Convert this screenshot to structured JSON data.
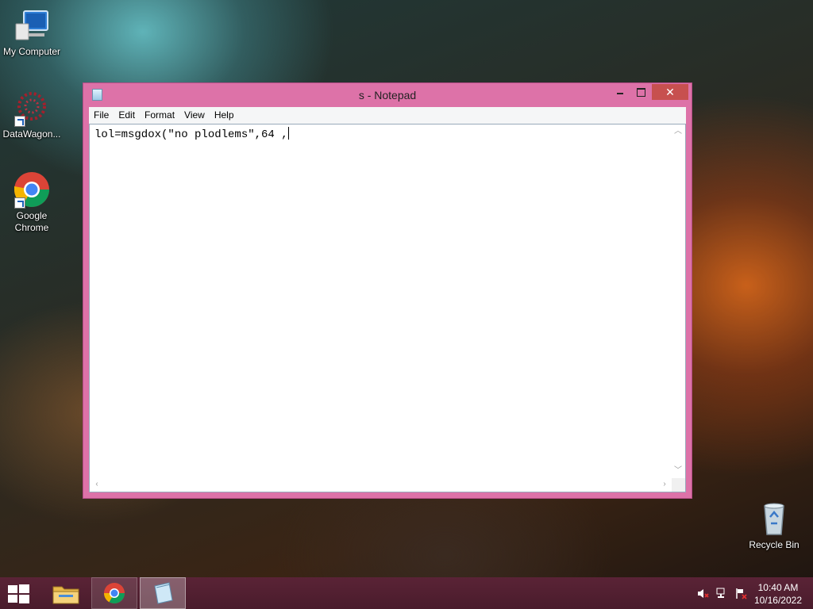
{
  "desktop": {
    "icons": [
      {
        "label": "My Computer",
        "icon": "computer-icon"
      },
      {
        "label": "DataWagon...",
        "icon": "datawagon-icon"
      },
      {
        "label": "Google Chrome",
        "icon": "chrome-icon"
      },
      {
        "label": "Recycle Bin",
        "icon": "recycle-bin-icon"
      }
    ]
  },
  "window": {
    "title": "s - Notepad",
    "close_glyph": "✕",
    "menu": [
      "File",
      "Edit",
      "Format",
      "View",
      "Help"
    ],
    "content": "lol=msgdox(\"no plodlems\",64 ,"
  },
  "taskbar": {
    "apps": [
      "start-icon",
      "file-explorer-icon",
      "chrome-icon",
      "notepad-icon"
    ],
    "clock": {
      "time": "10:40 AM",
      "date": "10/16/2022"
    }
  },
  "colors": {
    "window_frame": "#dd72a8",
    "taskbar": "#4a1c2c",
    "close_button": "#c7504f"
  }
}
